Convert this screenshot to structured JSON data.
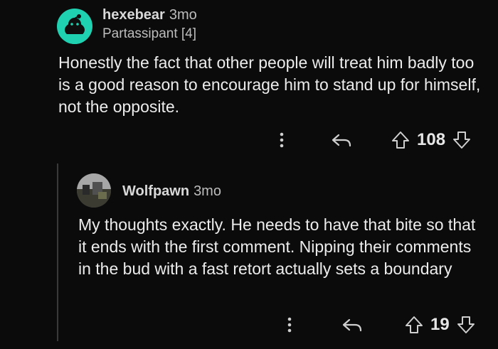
{
  "comments": [
    {
      "username": "hexebear",
      "age": "3mo",
      "flair": "Partassipant [4]",
      "text": "Honestly the fact that other people will treat him badly too is a good reason to encourage him to stand up for himself, not the opposite.",
      "score": "108",
      "avatar": "snoo-avatar-icon"
    },
    {
      "username": "Wolfpawn",
      "age": "3mo",
      "text": "My thoughts exactly. He needs to have that bite so that it ends with the first comment. Nipping their comments in the bud with a fast retort actually sets a boundary",
      "score": "19",
      "avatar": "user-photo-avatar"
    }
  ],
  "icons": {
    "more": "more-options-icon",
    "reply": "reply-icon",
    "upvote": "upvote-icon",
    "downvote": "downvote-icon"
  },
  "colors": {
    "background": "#0b0b0b",
    "avatar_teal": "#1fd1b1"
  }
}
